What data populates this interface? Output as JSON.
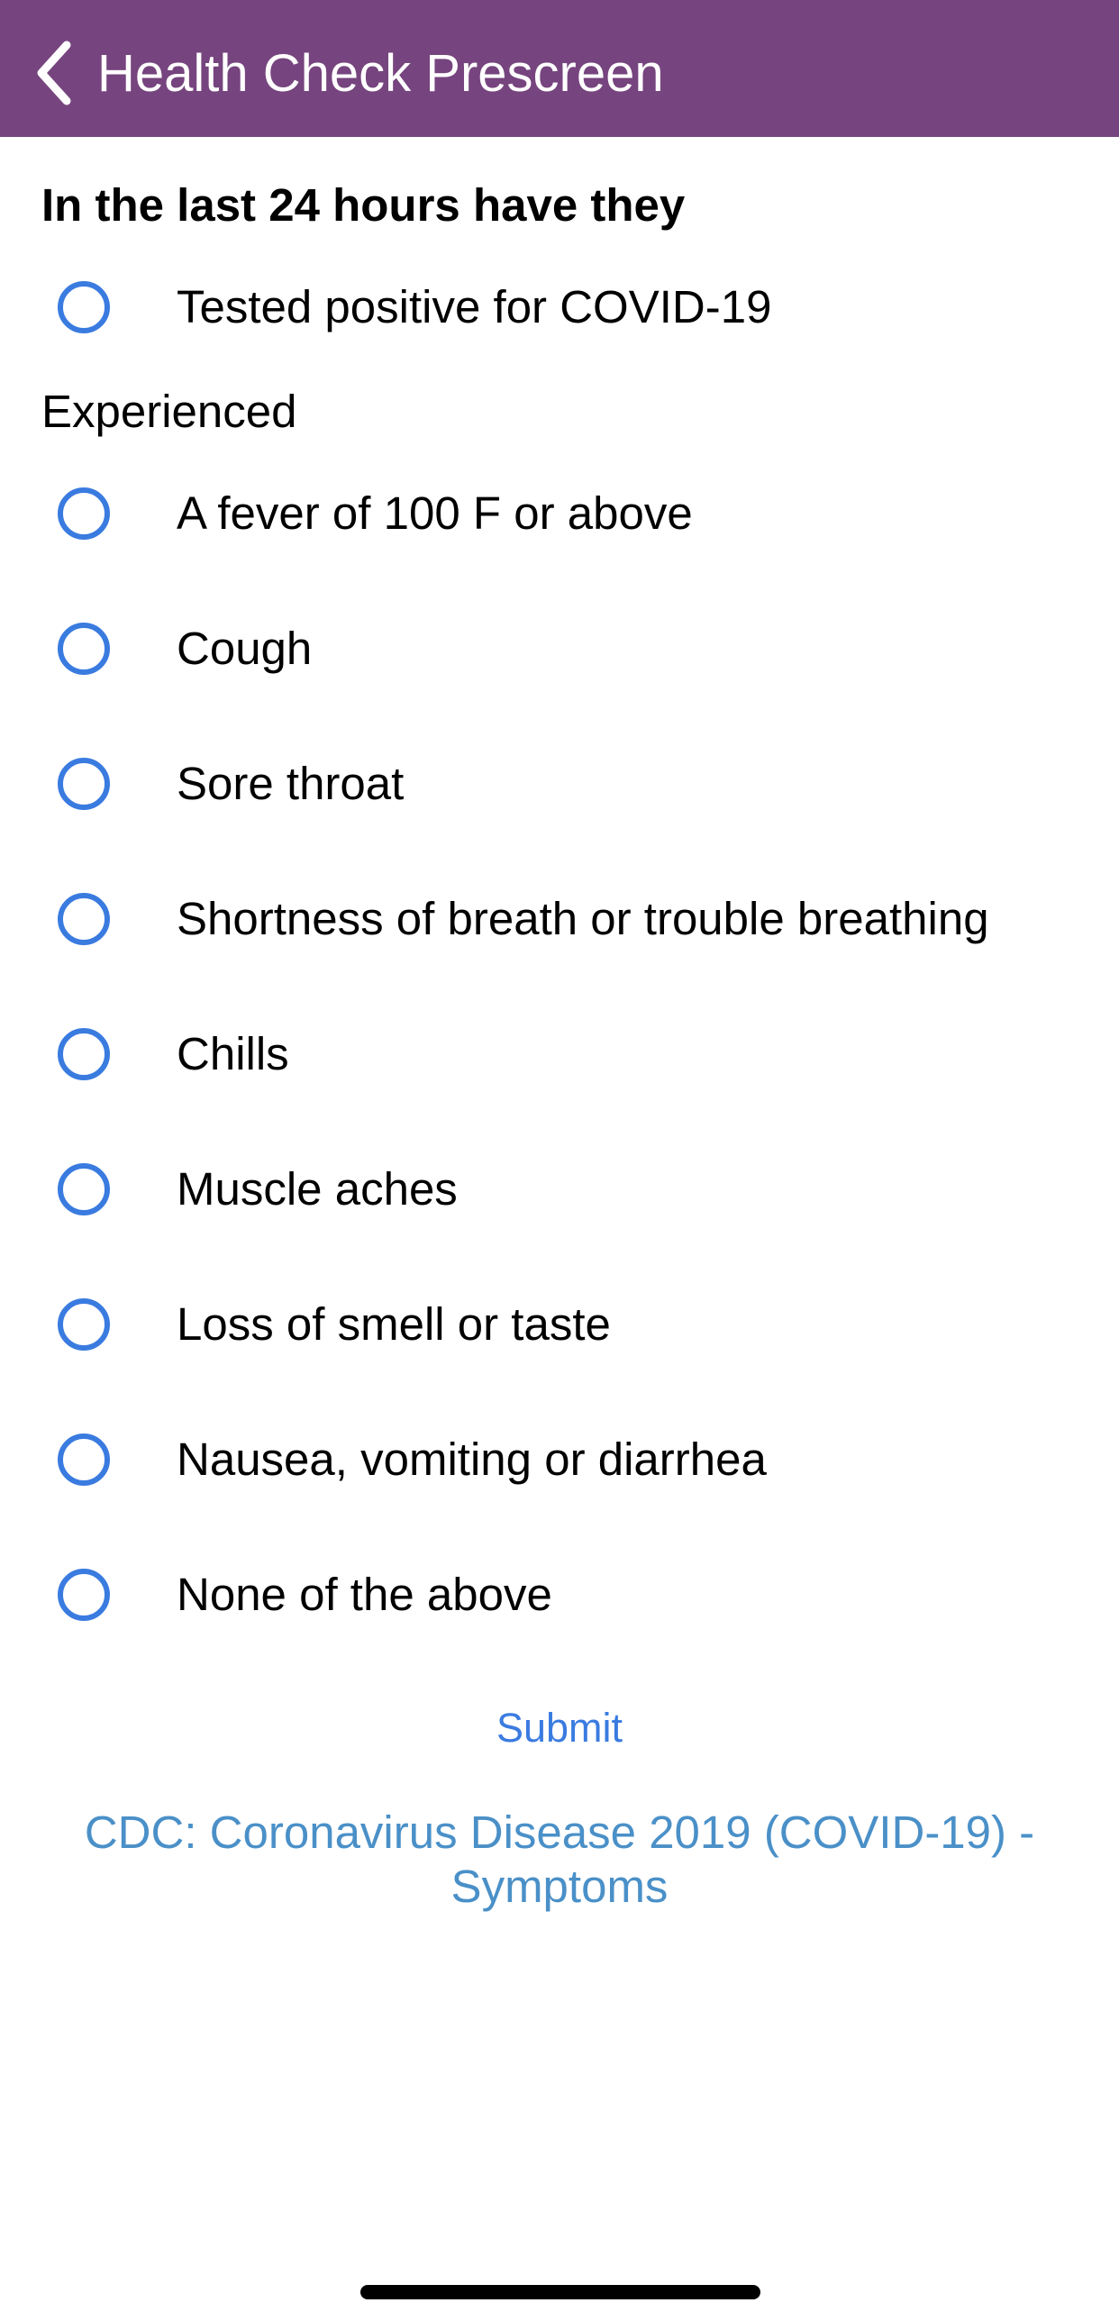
{
  "header": {
    "title": "Health Check Prescreen",
    "back_icon": "chevron-left-icon",
    "background": "#76447e"
  },
  "form": {
    "question_title": "In the last 24 hours have they",
    "primary_option": "Tested positive for COVID-19",
    "experienced_label": "Experienced",
    "symptoms": [
      "A fever of 100 F or above",
      "Cough",
      "Sore throat",
      "Shortness of breath or trouble breathing",
      "Chills",
      "Muscle aches",
      "Loss of smell or taste",
      "Nausea, vomiting or diarrhea",
      "None of the above"
    ],
    "radio_color": "#3a7be0"
  },
  "actions": {
    "submit_label": "Submit",
    "cdc_link": "CDC: Coronavirus Disease 2019 (COVID-19) - Symptoms",
    "link_color": "#4a90c8"
  }
}
